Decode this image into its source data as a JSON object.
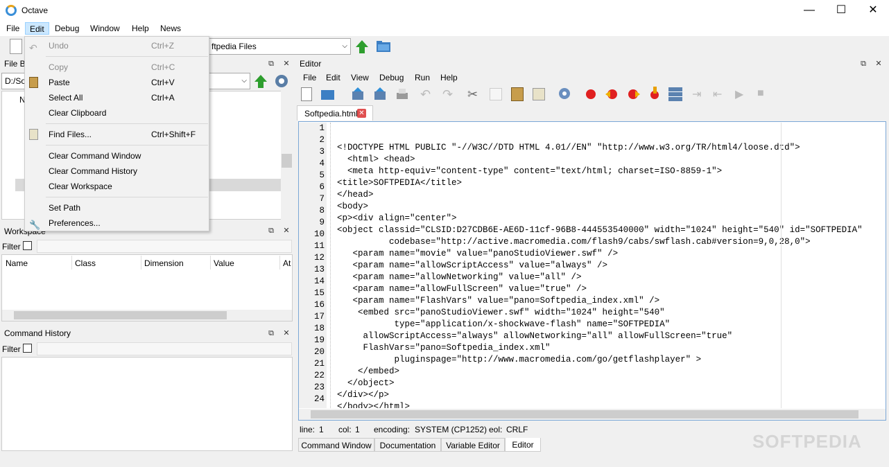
{
  "window": {
    "title": "Octave",
    "minimize": "—",
    "maximize": "☐",
    "close": "✕"
  },
  "menubar": [
    "File",
    "Edit",
    "Debug",
    "Window",
    "Help",
    "News"
  ],
  "toolbar": {
    "current_dir": "ftpedia Files"
  },
  "edit_menu": [
    {
      "label": "Undo",
      "shortcut": "Ctrl+Z"
    },
    {
      "label": "Copy",
      "shortcut": "Ctrl+C"
    },
    {
      "label": "Paste",
      "shortcut": "Ctrl+V"
    },
    {
      "label": "Select All",
      "shortcut": "Ctrl+A"
    },
    {
      "label": "Clear Clipboard",
      "shortcut": ""
    },
    {
      "label": "Find Files...",
      "shortcut": "Ctrl+Shift+F"
    },
    {
      "label": "Clear Command Window",
      "shortcut": ""
    },
    {
      "label": "Clear Command History",
      "shortcut": ""
    },
    {
      "label": "Clear Workspace",
      "shortcut": ""
    },
    {
      "label": "Set Path",
      "shortcut": ""
    },
    {
      "label": "Preferences...",
      "shortcut": ""
    }
  ],
  "file_browser": {
    "title": "File Br",
    "path": "D:/Sof",
    "first_item": "N"
  },
  "workspace": {
    "title": "Workspace",
    "filter_label": "Filter",
    "columns": [
      "Name",
      "Class",
      "Dimension",
      "Value",
      "At"
    ]
  },
  "command_history": {
    "title": "Command History",
    "filter_label": "Filter"
  },
  "editor": {
    "title": "Editor",
    "menu": [
      "File",
      "Edit",
      "View",
      "Debug",
      "Run",
      "Help"
    ],
    "tab_name": "Softpedia.html",
    "line_numbers": [
      "1",
      "2",
      "3",
      "4",
      "5",
      "6",
      "7",
      "8",
      "9",
      "10",
      "11",
      "12",
      "13",
      "14",
      "15",
      "16",
      "17",
      "18",
      "19",
      "20",
      "21",
      "22",
      "23",
      "24"
    ],
    "code_lines": [
      "<!DOCTYPE HTML PUBLIC \"-//W3C//DTD HTML 4.01//EN\" \"http://www.w3.org/TR/html4/loose.dtd\">",
      "  <html> <head>",
      "  <meta http-equiv=\"content-type\" content=\"text/html; charset=ISO-8859-1\">",
      "<title>SOFTPEDIA</title>",
      "</head>",
      "<body>",
      "<p><div align=\"center\">",
      "<object classid=\"CLSID:D27CDB6E-AE6D-11cf-96B8-444553540000\" width=\"1024\" height=\"540\" id=\"SOFTPEDIA\"",
      "          codebase=\"http://active.macromedia.com/flash9/cabs/swflash.cab#version=9,0,28,0\">",
      "   <param name=\"movie\" value=\"panoStudioViewer.swf\" />",
      "   <param name=\"allowScriptAccess\" value=\"always\" />",
      "   <param name=\"allowNetworking\" value=\"all\" />",
      "   <param name=\"allowFullScreen\" value=\"true\" />",
      "   <param name=\"FlashVars\" value=\"pano=Softpedia_index.xml\" />",
      "    <embed src=\"panoStudioViewer.swf\" width=\"1024\" height=\"540\"",
      "           type=\"application/x-shockwave-flash\" name=\"SOFTPEDIA\"",
      "     allowScriptAccess=\"always\" allowNetworking=\"all\" allowFullScreen=\"true\"",
      "     FlashVars=\"pano=Softpedia_index.xml\"",
      "           pluginspage=\"http://www.macromedia.com/go/getflashplayer\" >",
      "    </embed>",
      "  </object>",
      "</div></p>",
      "</body></html>",
      ""
    ]
  },
  "status": {
    "line_label": "line:",
    "line_value": "1",
    "col_label": "col:",
    "col_value": "1",
    "encoding_label": "encoding:",
    "encoding_value": "SYSTEM (CP1252)",
    "eol_label": "eol:",
    "eol_value": "CRLF"
  },
  "bottom_tabs": [
    "Command Window",
    "Documentation",
    "Variable Editor",
    "Editor"
  ],
  "watermark": "SOFTPEDIA"
}
